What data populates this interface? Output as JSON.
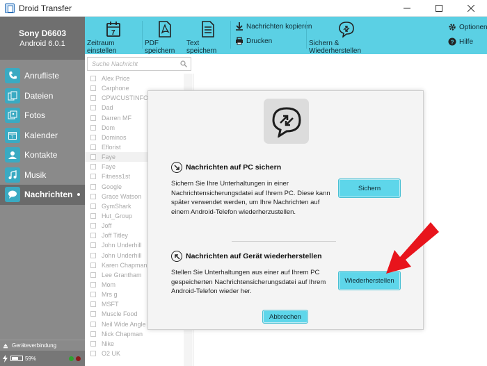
{
  "window": {
    "title": "Droid Transfer"
  },
  "device": {
    "name": "Sony D6603",
    "os": "Android 6.0.1"
  },
  "nav": [
    {
      "label": "Anrufliste",
      "icon": "phone-icon"
    },
    {
      "label": "Dateien",
      "icon": "files-icon"
    },
    {
      "label": "Fotos",
      "icon": "photos-icon"
    },
    {
      "label": "Kalender",
      "icon": "calendar-icon"
    },
    {
      "label": "Kontakte",
      "icon": "contacts-icon"
    },
    {
      "label": "Musik",
      "icon": "music-icon"
    },
    {
      "label": "Nachrichten",
      "icon": "messages-icon",
      "active": true
    }
  ],
  "footer": {
    "connection": "Geräteverbindung",
    "battery": "59%"
  },
  "toolbar": {
    "period": "Zeitraum einstellen",
    "pdf": "PDF speichern",
    "text": "Text speichern",
    "copy": "Nachrichten kopieren",
    "print": "Drucken",
    "backup": "Sichern & Wiederherstellen",
    "options": "Optionen",
    "help": "Hilfe"
  },
  "search": {
    "placeholder": "Suche Nachricht"
  },
  "contacts": [
    "Alex Price",
    "Carphone",
    "CPWCUSTINFO",
    "Dad",
    "Darren MF",
    "Dom",
    "Dominos",
    "Eflorist",
    "Faye",
    "Faye",
    "Fitness1st",
    "Google",
    "Grace Watson",
    "GymShark",
    "Hut_Group",
    "Joff",
    "Joff Titley",
    "John Underhill",
    "John Underhill",
    "Karen Chapman",
    "Lee Grantham",
    "Mom",
    "Mrs g",
    "MSFT",
    "Muscle Food",
    "Neil Wide Angle",
    "Nick Chapman",
    "Nike",
    "O2 UK"
  ],
  "selected_contact_index": 8,
  "modal": {
    "backup_title": "Nachrichten auf PC sichern",
    "backup_text": "Sichern Sie Ihre Unterhaltungen in einer Nachrichtensicherungsdatei auf Ihrem PC. Diese kann später verwendet werden, um Ihre Nachrichten auf einem Android-Telefon wiederherzustellen.",
    "backup_button": "Sichern",
    "restore_title": "Nachrichten auf Gerät wiederherstellen",
    "restore_text": "Stellen Sie Unterhaltungen aus einer auf Ihrem PC gespeicherten Nachrichtensicherungsdatei auf Ihrem Android-Telefon wieder her.",
    "restore_button": "Wiederherstellen",
    "cancel_button": "Abbrechen"
  },
  "colors": {
    "accent": "#5bd0e4",
    "sidebar": "#8a8a8a",
    "arrow": "#e8141c"
  }
}
